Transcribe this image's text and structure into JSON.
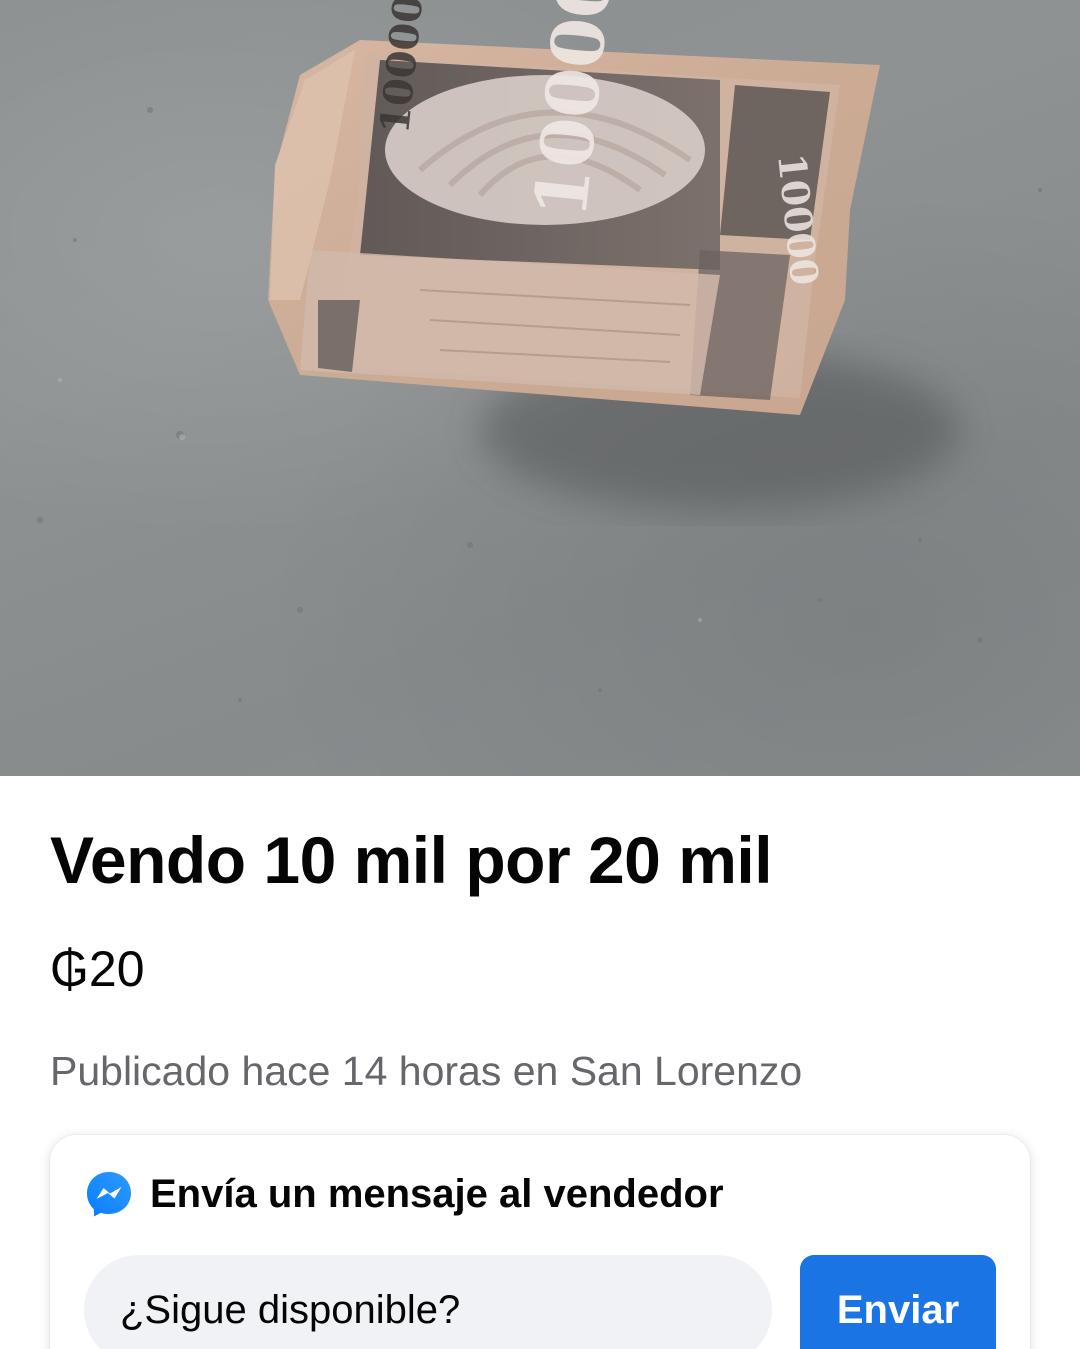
{
  "listing": {
    "image_alt": "Folded banknote on concrete floor",
    "banknote_denomination": "10000",
    "title": "Vendo 10 mil por 20 mil",
    "price": "₲20",
    "posted": "Publicado hace 14 horas en San Lorenzo"
  },
  "message": {
    "icon": "messenger-icon",
    "heading": "Envía un mensaje al vendedor",
    "input_value": "¿Sigue disponible?",
    "send_label": "Enviar"
  },
  "colors": {
    "accent": "#1b74e4",
    "text_primary": "#050505",
    "text_secondary": "#65676b",
    "input_background": "#f0f2f5"
  }
}
